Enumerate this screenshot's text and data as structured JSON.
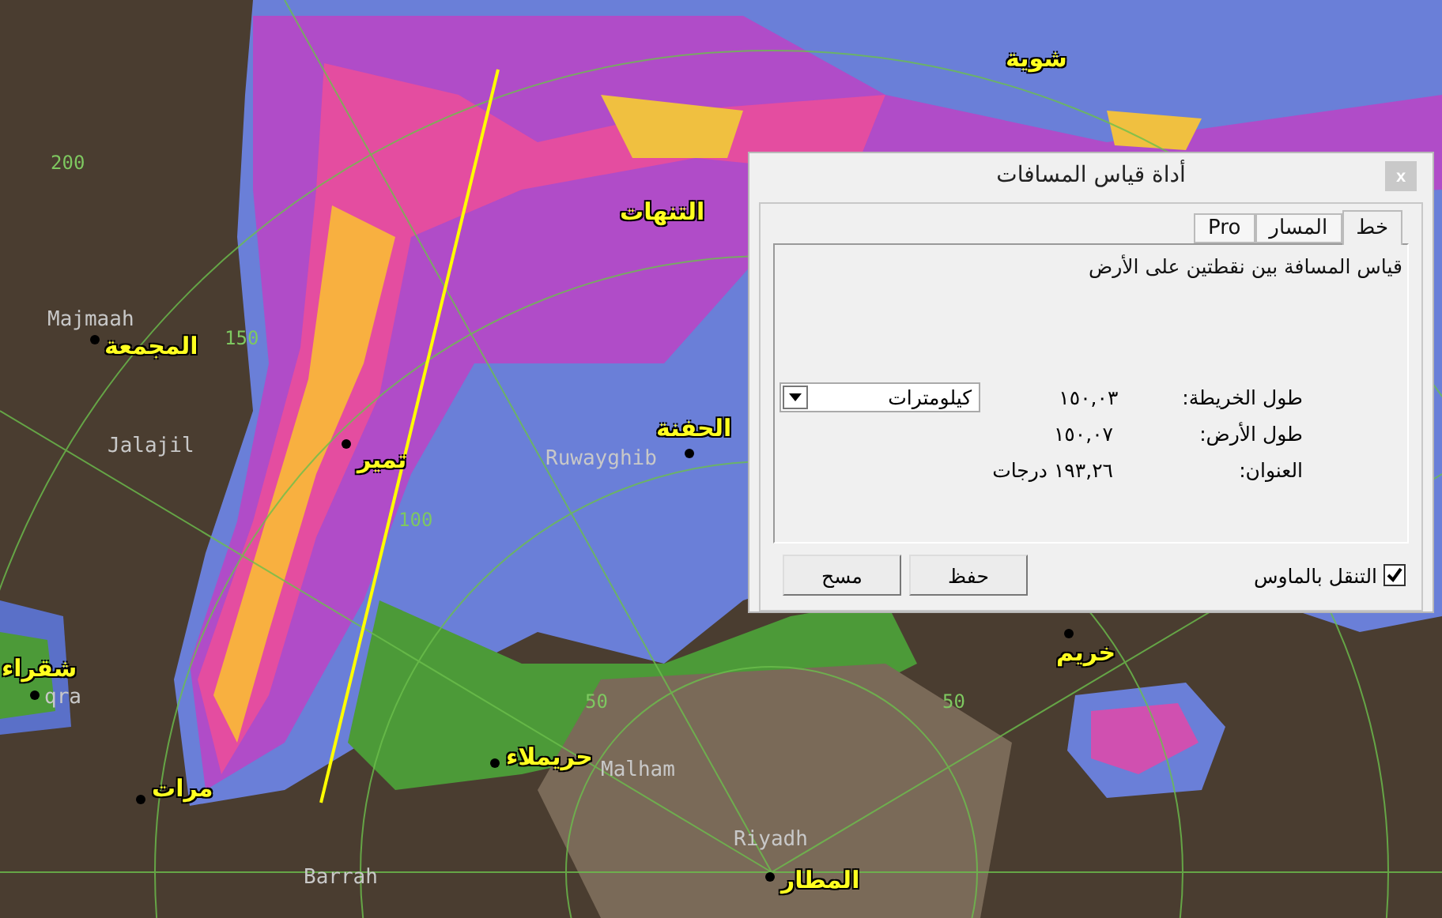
{
  "map": {
    "labels": [
      {
        "text": "شوية",
        "kind": "city"
      },
      {
        "text": "التنهات",
        "kind": "city"
      },
      {
        "text": "المجمعة",
        "kind": "city"
      },
      {
        "text": "تمير",
        "kind": "city"
      },
      {
        "text": "الحفنة",
        "kind": "city"
      },
      {
        "text": "شقراء",
        "kind": "city"
      },
      {
        "text": "مرات",
        "kind": "city"
      },
      {
        "text": "حريملاء",
        "kind": "city"
      },
      {
        "text": "خريم",
        "kind": "city"
      },
      {
        "text": "المطار",
        "kind": "city"
      },
      {
        "text": "Majmaah",
        "kind": "place"
      },
      {
        "text": "Jalajil",
        "kind": "place"
      },
      {
        "text": "Ruwayghib",
        "kind": "place"
      },
      {
        "text": "qra",
        "kind": "place"
      },
      {
        "text": "Malham",
        "kind": "place"
      },
      {
        "text": "Riyadh",
        "kind": "place"
      },
      {
        "text": "Barrah",
        "kind": "place"
      },
      {
        "text": "200",
        "kind": "range"
      },
      {
        "text": "150",
        "kind": "range"
      },
      {
        "text": "100",
        "kind": "range"
      },
      {
        "text": "50",
        "kind": "range"
      },
      {
        "text": "50",
        "kind": "range"
      }
    ]
  },
  "dialog": {
    "title": "أداة قياس المسافات",
    "close": "x",
    "tabs": [
      {
        "label": "خط",
        "selected": true
      },
      {
        "label": "المسار",
        "selected": false
      },
      {
        "label": "Pro",
        "selected": false
      }
    ],
    "description": "قياس المسافة بين نقطتين على الأرض",
    "rows": [
      {
        "label": "طول الخريطة:",
        "value": "١٥٠,٠٣",
        "unit": "كيلومترات"
      },
      {
        "label": "طول الأرض:",
        "value": "١٥٠,٠٧"
      },
      {
        "label": "العنوان:",
        "value": "١٩٣,٢٦ درجات"
      }
    ],
    "mouse_nav": {
      "label": "التنقل بالماوس",
      "checked": true
    },
    "buttons": [
      "حفظ",
      "مسح"
    ]
  }
}
